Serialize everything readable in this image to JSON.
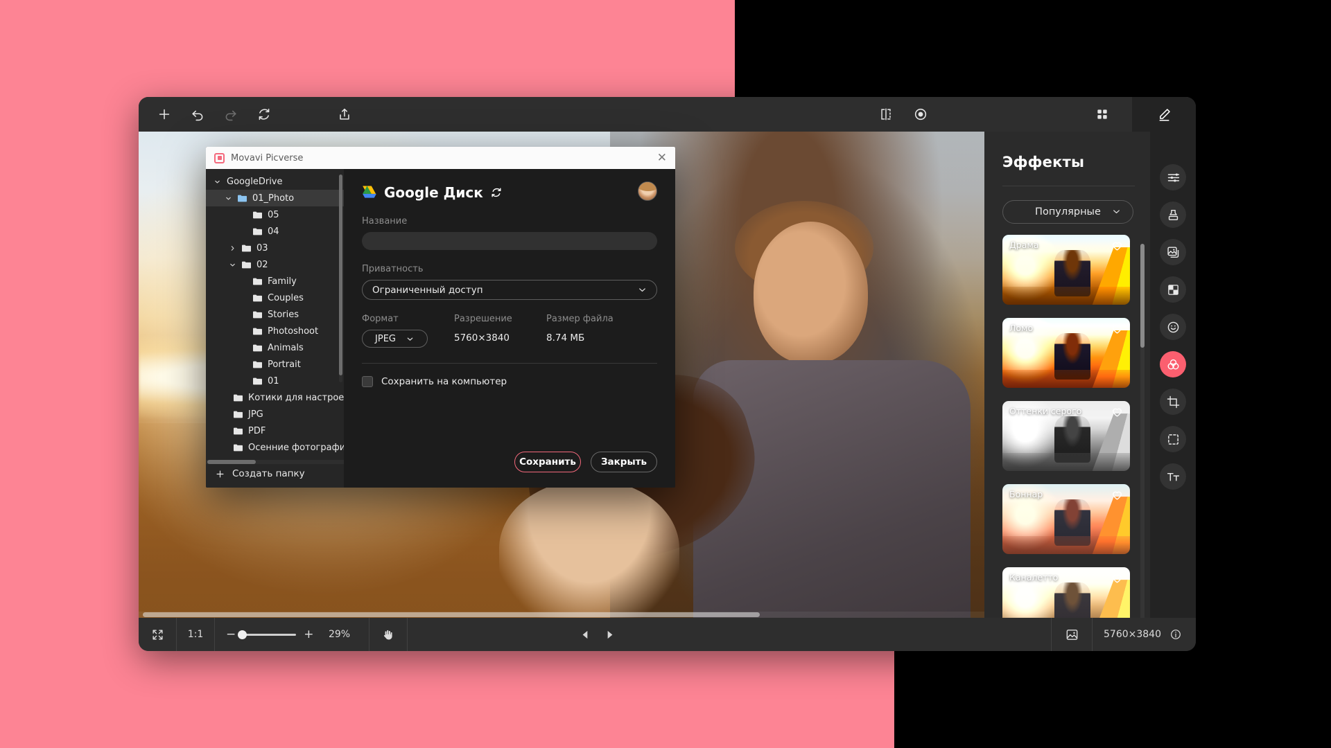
{
  "app": {
    "window_title": "Movavi Picverse"
  },
  "toolbar": {
    "add_label": "add-icon",
    "undo_label": "undo-icon",
    "redo_label": "redo-icon",
    "rotate_label": "rotate-icon",
    "share_label": "share-icon",
    "compare_label": "compare-icon",
    "preview_label": "preview-icon",
    "grid_label": "grid-icon",
    "edit_label": "edit-icon"
  },
  "dialog": {
    "title": "Movavi Picverse",
    "close_label": "✕",
    "provider_name": "Google Диск",
    "refresh_label": "refresh-icon",
    "fields": {
      "name_label": "Название",
      "name_value": "",
      "name_placeholder": "",
      "privacy_label": "Приватность",
      "privacy_value": "Ограниченный доступ",
      "format_label": "Формат",
      "format_value": "JPEG",
      "resolution_label": "Разрешение",
      "resolution_value": "5760×3840",
      "filesize_label": "Размер файла",
      "filesize_value": "8.74 МБ",
      "save_local_label": "Сохранить на компьютер",
      "save_local_checked": false
    },
    "buttons": {
      "save": "Сохранить",
      "close": "Закрыть"
    },
    "tree": {
      "create_folder_label": "Создать папку",
      "items": [
        {
          "label": "GoogleDrive",
          "depth": 0,
          "twisty": "down",
          "folder": false,
          "selected": false
        },
        {
          "label": "01_Photo",
          "depth": 1,
          "twisty": "down",
          "folder": true,
          "selected": true,
          "blue": true
        },
        {
          "label": "05",
          "depth": 2,
          "twisty": "none",
          "folder": true,
          "selected": false
        },
        {
          "label": "04",
          "depth": 2,
          "twisty": "none",
          "folder": true,
          "selected": false
        },
        {
          "label": "03",
          "depth": 2,
          "twisty": "right",
          "folder": true,
          "selected": false
        },
        {
          "label": "02",
          "depth": 2,
          "twisty": "down",
          "folder": true,
          "selected": false
        },
        {
          "label": "Family",
          "depth": 3,
          "twisty": "none",
          "folder": true,
          "selected": false
        },
        {
          "label": "Couples",
          "depth": 3,
          "twisty": "none",
          "folder": true,
          "selected": false
        },
        {
          "label": "Stories",
          "depth": 3,
          "twisty": "none",
          "folder": true,
          "selected": false
        },
        {
          "label": "Photoshoot",
          "depth": 3,
          "twisty": "none",
          "folder": true,
          "selected": false
        },
        {
          "label": "Animals",
          "depth": 3,
          "twisty": "none",
          "folder": true,
          "selected": false
        },
        {
          "label": "Portrait",
          "depth": 3,
          "twisty": "none",
          "folder": true,
          "selected": false
        },
        {
          "label": "01",
          "depth": 2,
          "twisty": "none",
          "folder": true,
          "selected": false
        },
        {
          "label": "Котики для настроения",
          "depth": 1,
          "twisty": "none",
          "folder": true,
          "selected": false
        },
        {
          "label": "JPG",
          "depth": 1,
          "twisty": "none",
          "folder": true,
          "selected": false
        },
        {
          "label": "PDF",
          "depth": 1,
          "twisty": "none",
          "folder": true,
          "selected": false
        },
        {
          "label": "Осенние фотографии",
          "depth": 1,
          "twisty": "none",
          "folder": true,
          "selected": false
        }
      ]
    }
  },
  "effects": {
    "title": "Эффекты",
    "filter_value": "Популярные",
    "items": [
      {
        "label": "Драма",
        "style": "f-drama",
        "favorite": false
      },
      {
        "label": "Ломо",
        "style": "f-lomo",
        "favorite": false
      },
      {
        "label": "Оттенки серого",
        "style": "f-gray",
        "favorite": false
      },
      {
        "label": "Боннар",
        "style": "f-bonnar",
        "favorite": false
      },
      {
        "label": "Каналетто",
        "style": "f-canal",
        "favorite": false
      }
    ]
  },
  "rail": {
    "items": [
      {
        "name": "adjust-icon",
        "active": false
      },
      {
        "name": "stamp-icon",
        "active": false
      },
      {
        "name": "images-icon",
        "active": false
      },
      {
        "name": "layers-icon",
        "active": false
      },
      {
        "name": "smiley-icon",
        "active": false
      },
      {
        "name": "effects-icon",
        "active": true
      },
      {
        "name": "crop-icon",
        "active": false
      },
      {
        "name": "selection-icon",
        "active": false
      },
      {
        "name": "text-icon",
        "active": false
      }
    ]
  },
  "statusbar": {
    "fit_label": "fit-icon",
    "ratio_label": "1:1",
    "minus_label": "−",
    "plus_label": "+",
    "zoom_value": "29%",
    "hand_label": "hand-icon",
    "prev_label": "prev-icon",
    "next_label": "next-icon",
    "image_icon_label": "image-icon",
    "resolution": "5760×3840",
    "info_label": "info-icon"
  },
  "colors": {
    "accent_pink": "#fb5f6f",
    "background_pink": "#fd8494",
    "panel_dark": "#2b2b2b",
    "dialog_dark": "#1c1c1c"
  }
}
